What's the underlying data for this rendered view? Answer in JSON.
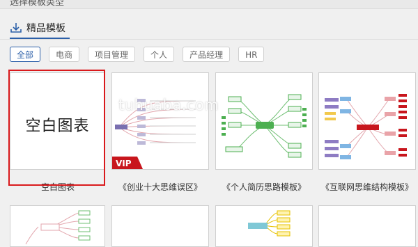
{
  "header": {
    "cut_text": "选择模板类型"
  },
  "section_tab": {
    "label": "精品模板",
    "icon": "download-icon"
  },
  "filters": [
    {
      "label": "全部",
      "active": true
    },
    {
      "label": "电商",
      "active": false
    },
    {
      "label": "项目管理",
      "active": false
    },
    {
      "label": "个人",
      "active": false
    },
    {
      "label": "产品经理",
      "active": false
    },
    {
      "label": "HR",
      "active": false
    }
  ],
  "cards": [
    {
      "title": "空白图表",
      "inner_text": "空白图表",
      "selected": true
    },
    {
      "title": "《创业十大思维误区》",
      "badge": "VIP"
    },
    {
      "title": "《个人简历思路模板》"
    },
    {
      "title": "《互联网思维结构模板》"
    }
  ],
  "watermark": "tuhuaba.com",
  "colors": {
    "accent": "#2b5fa8",
    "selection": "#d9191c",
    "vip": "#c8161d",
    "map_green": "#4caf50"
  }
}
